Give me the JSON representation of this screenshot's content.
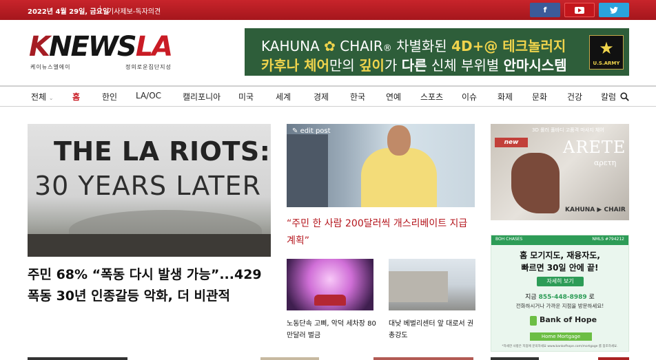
{
  "topbar": {
    "date": "2022년 4월 29일, 금요일",
    "report_link": "기사제보-독자의견",
    "social": [
      {
        "name": "facebook",
        "glyph": "f",
        "color": "#3b5b99"
      },
      {
        "name": "youtube",
        "color": "#c4161c"
      },
      {
        "name": "twitter",
        "glyph": "🐦",
        "color": "#2aa3dc"
      }
    ]
  },
  "logo": {
    "k": "K",
    "news": "NEWS",
    "la": "LA",
    "sub_left": "케이뉴스엘에이",
    "sub_right": "정의로운집단지성"
  },
  "banner": {
    "line1_a": "KAHUNA",
    "line1_flower": "✿",
    "line1_b": "CHAIR",
    "line1_reg": "®",
    "line1_c": " 차별화된 ",
    "line1_hl": "4D+@ 테크놀러지",
    "line2_a": "카후나 체어",
    "line2_b": "만의 ",
    "line2_c": "깊이",
    "line2_d": "가 ",
    "line2_e": "다른",
    "line2_f": " 신체 부위별 ",
    "line2_g": "안마시스템",
    "army_label": "U.S.ARMY",
    "army_star": "★",
    "accent": "#f0d44c",
    "bg": "#2e5e3a"
  },
  "nav": {
    "items": [
      "전체",
      "홈",
      "한인",
      "LA/OC",
      "캘리포니아",
      "미국",
      "세계",
      "경제",
      "한국",
      "연예",
      "스포츠",
      "이슈",
      "화제",
      "문화",
      "건강",
      "칼럼"
    ],
    "caret": "⌄",
    "active": "홈",
    "accent": "#c91c25"
  },
  "main_story": {
    "image_line1": "THE LA RIOTS:",
    "image_line2": "30 YEARS LATER",
    "headline": "주민 68% “폭동 다시 발생 가능”...429 폭동 30년 인종갈등 악화, 더 비관적"
  },
  "mid_story": {
    "edit_label": "edit post",
    "headline": "“주민 한 사람 200달러씩 개스리베이트 지급 계획”"
  },
  "thumbs": [
    {
      "caption": "노동단속 고삐, 악덕 세차장 80만달러 벌금"
    },
    {
      "caption": "대낮 베벌리센터 앞 대로서 권총강도"
    }
  ],
  "ad_chair": {
    "badge": "new",
    "top_text": "3D 롤러 풀바디 고품격 마사지 체어",
    "title": "ARETE",
    "subtitle": "αρετη",
    "brand": "KAHUNA ▶ CHAIR"
  },
  "ad_bank": {
    "header_left": "BOH CHASES",
    "header_right": "NMLS #794212",
    "headline_1": "홈 모기지도, 재융자도,",
    "headline_2": "빠르면 30일 안에 끝!",
    "button": "자세히 보기",
    "phone_prefix": "지금 ",
    "phone": "855-448-8989",
    "phone_suffix": " 로",
    "desc": "전화하시거나 가까운 지점을 방문하세요!",
    "bank_name": "Bank of Hope",
    "sub_button": "Home Mortgage",
    "fine_print": "*자세한 사항은 지점에 문의하세요 www.bankofhope.com/mortgage 를 참조하세요.",
    "accent": "#2d9c57"
  }
}
